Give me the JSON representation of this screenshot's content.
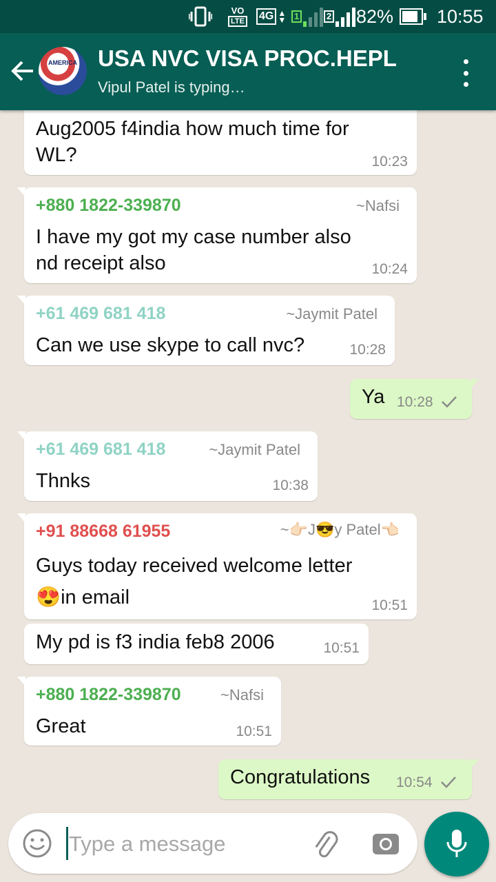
{
  "status_bar": {
    "volte_label": "VO",
    "lte_label": "LTE",
    "net_label": "4G",
    "sim1": "1",
    "sim2": "2",
    "battery": "82%",
    "time": "10:55"
  },
  "header": {
    "title": "USA NVC VISA PROC.HEPL",
    "subtitle": "Vipul Patel is typing…",
    "avatar_text": "AMERICA"
  },
  "messages": [
    {
      "text_lines": [
        "Aug2005 f4india how much time for",
        "WL?"
      ],
      "time": "10:23"
    },
    {
      "sender": "+880 1822-339870",
      "alias": "~Nafsi",
      "text_lines": [
        "I have my got my case number also",
        "nd receipt also"
      ],
      "time": "10:24"
    },
    {
      "sender": "+61 469 681 418",
      "alias": "~Jaymit Patel",
      "text_lines": [
        "Can we use skype to call nvc?"
      ],
      "time": "10:28"
    },
    {
      "text_lines": [
        "Ya"
      ],
      "time": "10:28"
    },
    {
      "sender": "+61 469 681 418",
      "alias": "~Jaymit Patel",
      "text_lines": [
        "Thnks"
      ],
      "time": "10:38"
    },
    {
      "sender": "+91 88668 61955",
      "alias": "~👉🏻J😎y Patel👈🏻",
      "text_lines": [
        "Guys today received welcome letter",
        "😍in email"
      ],
      "time": "10:51"
    },
    {
      "text_lines": [
        "My pd is f3 india feb8 2006"
      ],
      "time": "10:51"
    },
    {
      "sender": "+880 1822-339870",
      "alias": "~Nafsi",
      "text_lines": [
        "Great"
      ],
      "time": "10:51"
    },
    {
      "text_lines": [
        "Congratulations"
      ],
      "time": "10:54"
    }
  ],
  "colors": {
    "header": "#075e54",
    "status_bar": "#054d44",
    "outgoing": "#dcf8c6",
    "sender_green": "#4caf50",
    "sender_teal": "#8fd3c4",
    "sender_red": "#e04f4f"
  },
  "composer": {
    "placeholder": "Type a message",
    "icons": [
      "emoji-icon",
      "attach-icon",
      "camera-icon",
      "mic-icon"
    ]
  }
}
